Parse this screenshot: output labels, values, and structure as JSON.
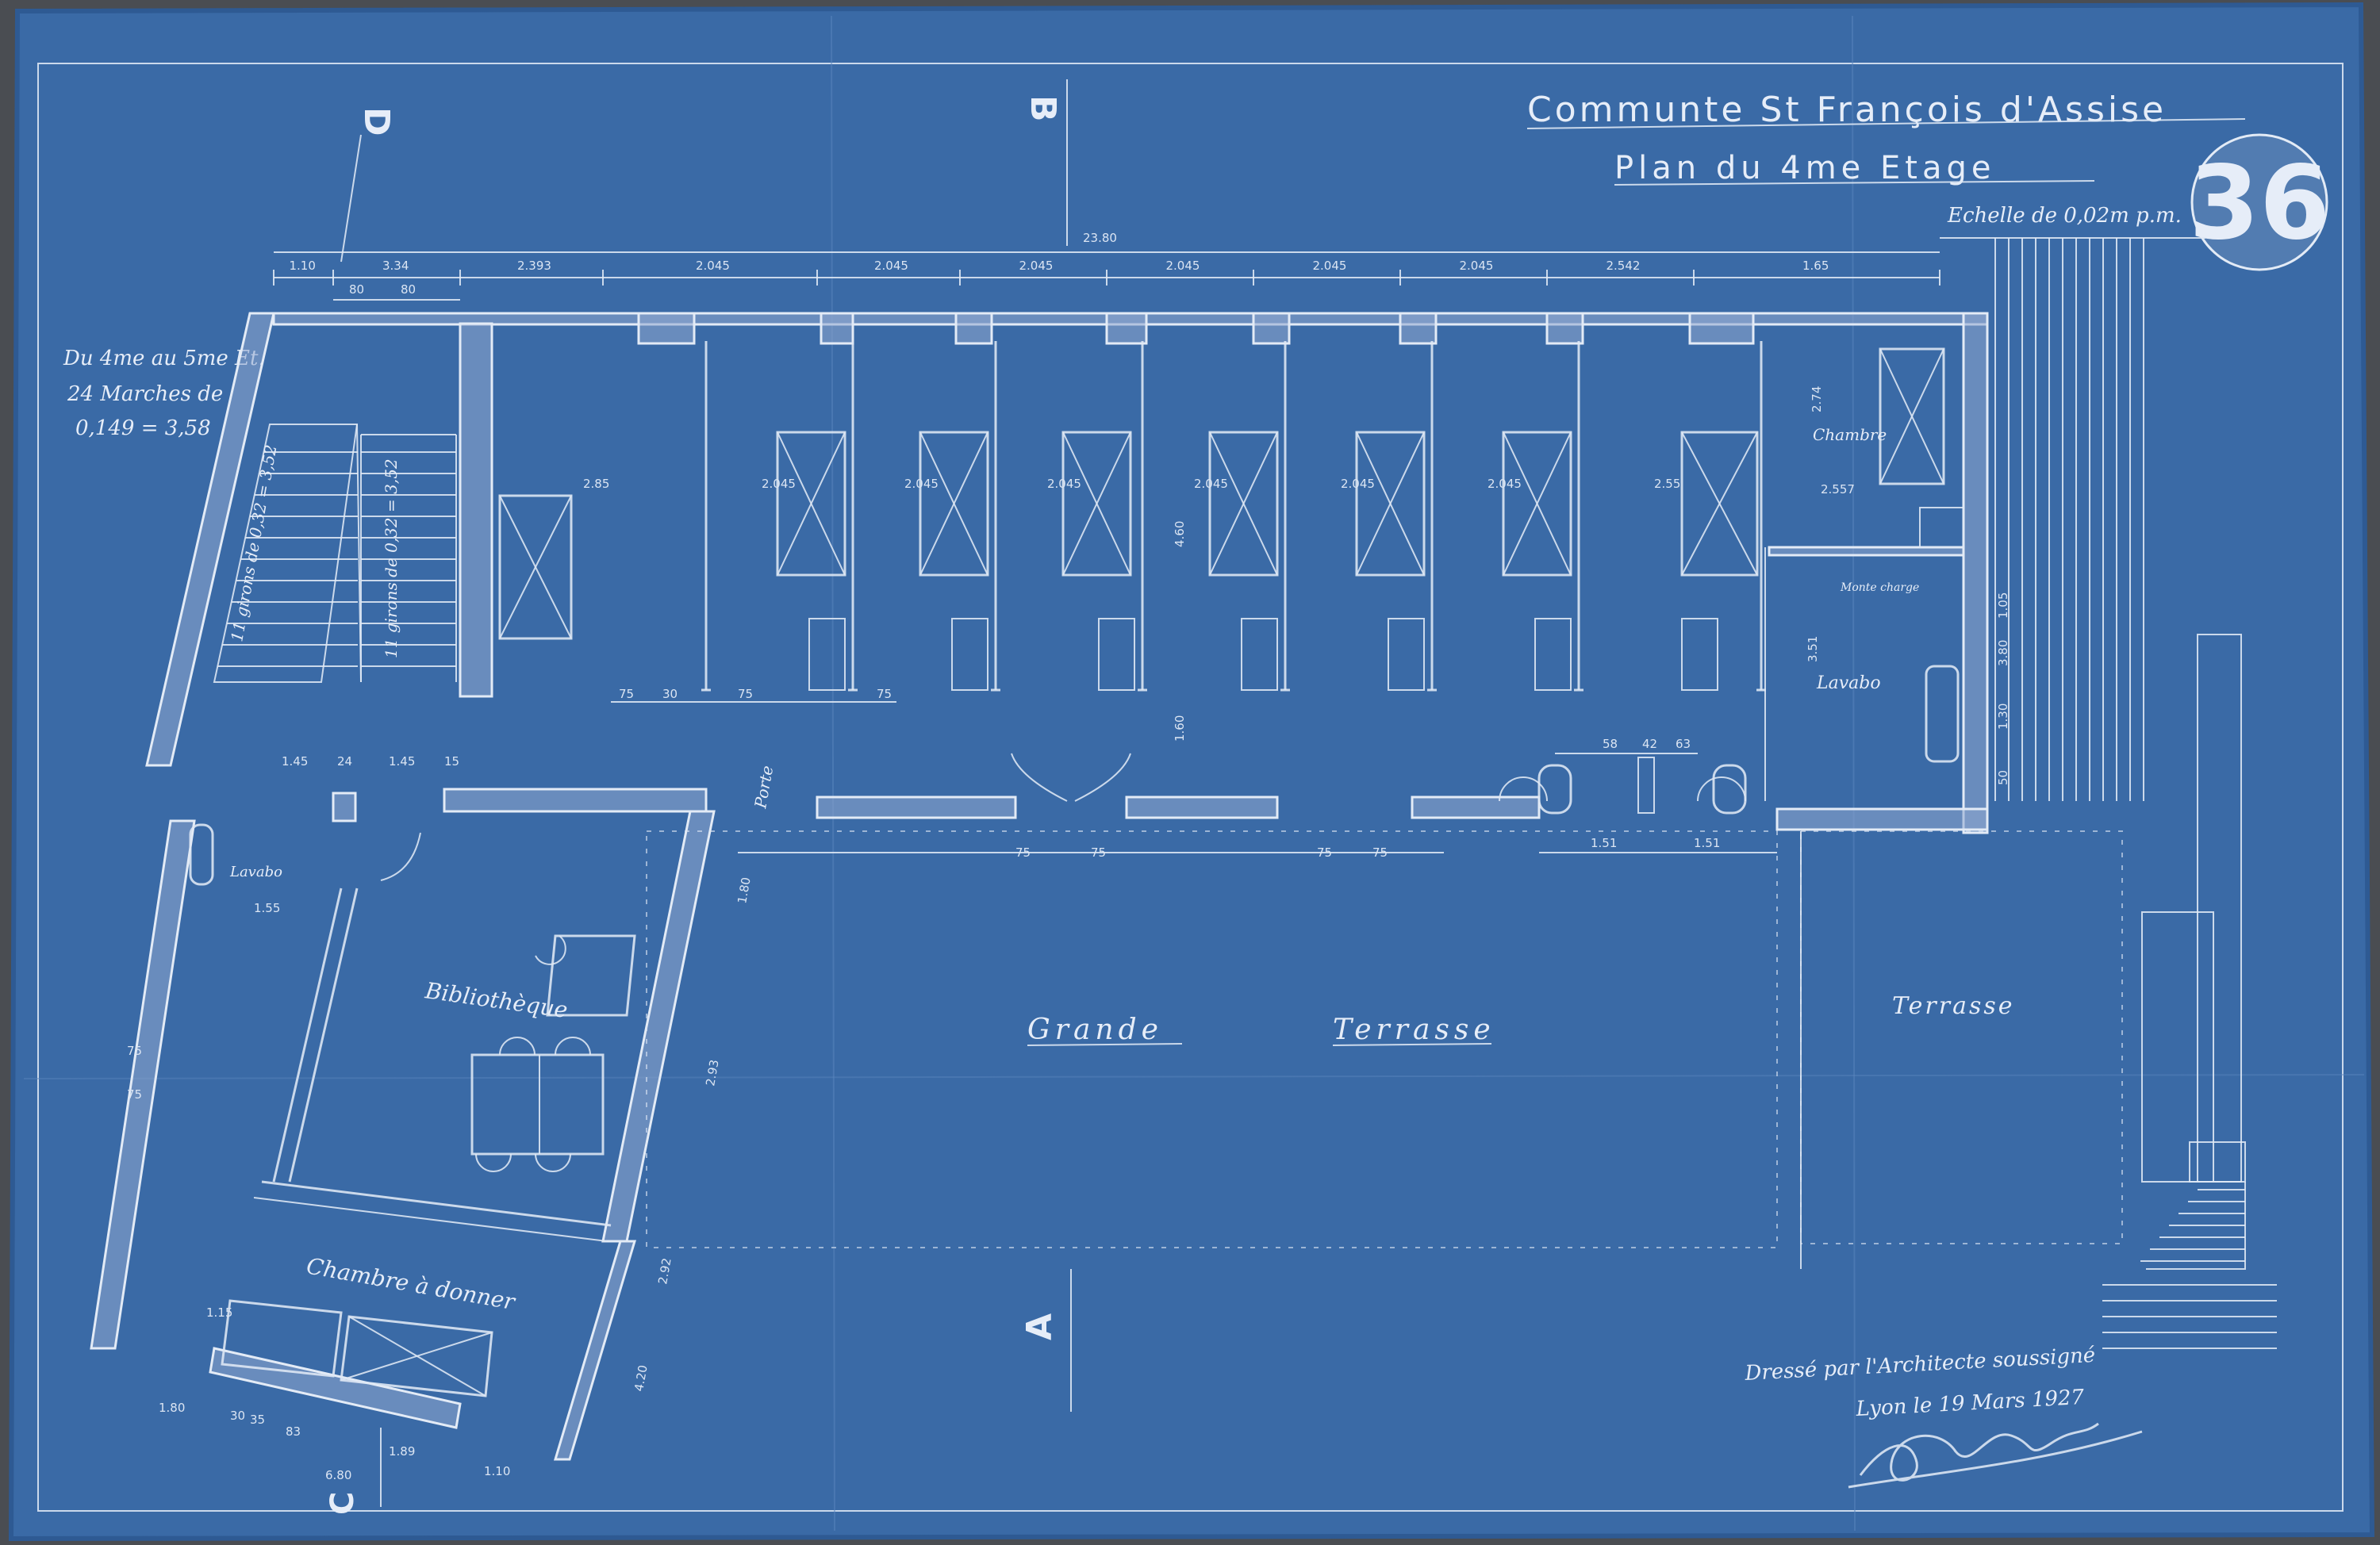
{
  "colors": {
    "paper": "#3a6aa6",
    "paper_edge": "#2e5a93",
    "background": "#4a4d52",
    "ink": "#e6edf8"
  },
  "title": {
    "line1": "Communte St François d'Assise",
    "line2": "Plan du 4me Etage",
    "scale": "Echelle de 0,02m p.m.",
    "sheet_number": "36"
  },
  "section_marks": {
    "a": "A",
    "b": "B",
    "c": "C",
    "d": "D"
  },
  "stair_note": {
    "line1": "Du 4me au 5me Et.",
    "line2": "24 Marches de",
    "line3": "0,149 = 3,58"
  },
  "flights": {
    "left": "11 girons de 0,32 = 3,52",
    "right": "11 girons de 0,32 = 3,52"
  },
  "rooms": {
    "bibliotheque": "Bibliothèque",
    "chambre_a_donner": "Chambre à donner",
    "grande": "Grande",
    "terrasse_main": "Terrasse",
    "terrasse_side": "Terrasse",
    "chambre": "Chambre",
    "lavabo_right": "Lavabo",
    "lavabo_left": "Lavabo",
    "porte": "Porte",
    "monte_charge": "Monte charge"
  },
  "dimensions": {
    "overall": "23.80",
    "top_chain": [
      "1.10",
      "3.34",
      "2.393",
      "2.045",
      "2.045",
      "2.045",
      "2.045",
      "2.045",
      "2.045",
      "2.542",
      "1.65"
    ],
    "top_small": [
      "80",
      "80"
    ],
    "room_widths": [
      "2.85",
      "2.045",
      "2.045",
      "2.045",
      "2.045",
      "2.045",
      "2.045",
      "2.55"
    ],
    "room_depth": "4.60",
    "corridor": "1.60",
    "right_room_depth": "2.74",
    "right_room_width": "2.557",
    "lavabo_depth": "3.51",
    "door_widths": [
      "75",
      "30",
      "75",
      "75",
      "75",
      "75",
      "75",
      "75"
    ],
    "sanitary": [
      "58",
      "42",
      "63"
    ],
    "sanitary_bottom": [
      "1.51",
      "1.51"
    ],
    "left_block": [
      "1.45",
      "24",
      "1.45",
      "15",
      "1.55",
      "1.80",
      "1.15",
      "1.10",
      "75",
      "75",
      "6.80",
      "1.89",
      "83",
      "30",
      "35"
    ],
    "diag": [
      "2.93",
      "2.92",
      "4.20",
      "1.80"
    ],
    "right_strip": [
      "1.05",
      "3.80",
      "1.30",
      "50"
    ]
  },
  "signature_block": {
    "line1": "Dressé par l'Architecte soussigné",
    "line2": "Lyon le 19 Mars 1927"
  }
}
